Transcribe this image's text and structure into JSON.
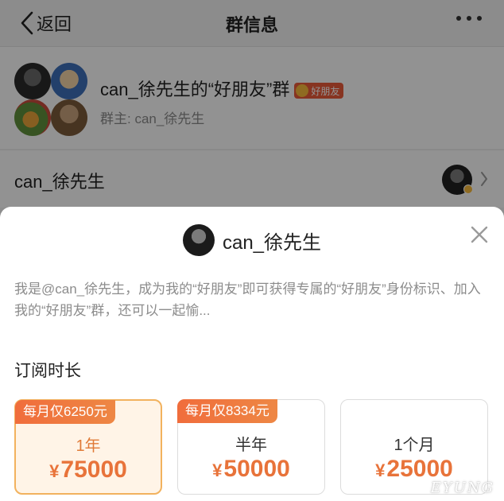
{
  "nav": {
    "back_label": "返回",
    "title": "群信息"
  },
  "group": {
    "name": "can_徐先生的“好朋友”群",
    "badge": "好朋友",
    "owner": "群主: can_徐先生"
  },
  "member_row": {
    "name": "can_徐先生"
  },
  "sheet": {
    "name": "can_徐先生",
    "description": "我是@can_徐先生，成为我的“好朋友”即可获得专属的“好朋友”身份标识、加入我的“好朋友”群，还可以一起愉...",
    "section_title": "订阅时长",
    "plans": [
      {
        "tag": "每月仅6250元",
        "duration": "1年",
        "currency": "¥",
        "price": "75000",
        "selected": true
      },
      {
        "tag": "每月仅8334元",
        "duration": "半年",
        "currency": "¥",
        "price": "50000",
        "selected": false
      },
      {
        "tag": "",
        "duration": "1个月",
        "currency": "¥",
        "price": "25000",
        "selected": false
      }
    ]
  },
  "watermark": "EYUNG",
  "colors": {
    "accent": "#e8733a",
    "badge_red": "#e85b3a",
    "selected_border": "#f2b25e"
  }
}
